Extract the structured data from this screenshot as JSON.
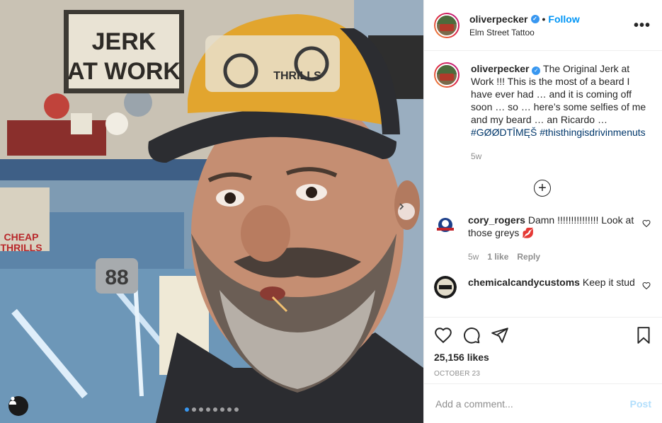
{
  "post": {
    "username": "oliverpecker",
    "follow_label": "Follow",
    "location": "Elm Street Tattoo",
    "more_label": "•••",
    "image_texts": {
      "sign": "JERK AT WORK",
      "hat_text": "THRILLS",
      "poster_text": "CHEAP THRILLS",
      "plate_text": "88"
    }
  },
  "caption": {
    "username": "oliverpecker",
    "text": "The Original Jerk at Work !!! This is the most of a beard I have ever had … and it is coming off soon … so … here’s some selfies of me and my beard … an Ricardo …",
    "hashtag_1": "#GØØDTĪMĘŠ",
    "hashtag_2": "#thisthingisdrivinmenuts",
    "age": "5w"
  },
  "load_more_label": "+",
  "comments": [
    {
      "username": "cory_rogers",
      "text": "Damn !!!!!!!!!!!!!!! Look at those greys 💋",
      "age": "5w",
      "likes": "1 like",
      "reply": "Reply"
    },
    {
      "username": "chemicalcandycustoms",
      "text": "Keep it stud"
    }
  ],
  "engagement": {
    "likes": "25,156 likes",
    "date": "OCTOBER 23"
  },
  "composer": {
    "placeholder": "Add a comment...",
    "post_label": "Post"
  },
  "carousel": {
    "slide_count": 8,
    "active_index": 0
  },
  "colors": {
    "accent": "#0095f6",
    "hashtag": "#00376b",
    "muted": "#8e8e8e",
    "post_disabled": "#b2dffc"
  }
}
